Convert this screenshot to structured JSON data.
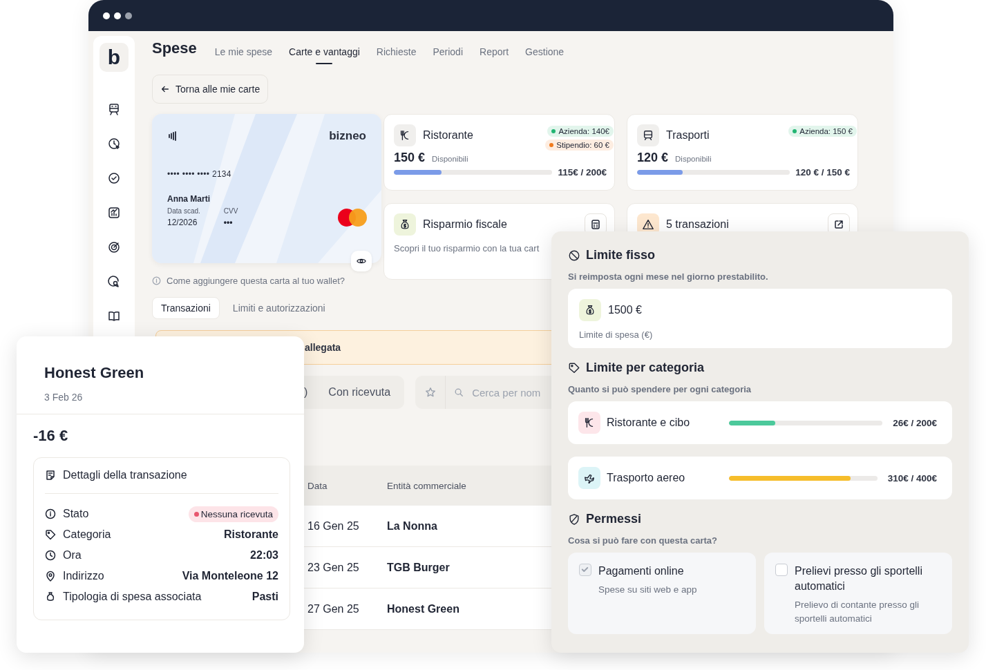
{
  "sidebar": {
    "logo": "b"
  },
  "header": {
    "title": "Spese",
    "tabs": [
      {
        "label": "Le mie spese",
        "selected": false
      },
      {
        "label": "Carte e vantaggi",
        "selected": true
      },
      {
        "label": "Richieste",
        "selected": false
      },
      {
        "label": "Periodi",
        "selected": false
      },
      {
        "label": "Report",
        "selected": false
      },
      {
        "label": "Gestione",
        "selected": false
      }
    ]
  },
  "back_button": "Torna alle mie carte",
  "card": {
    "brand": "bizneo",
    "number": "•••• •••• •••• 2134",
    "holder": "Anna Marti",
    "expiry_label": "Data scad.",
    "expiry": "12/2026",
    "cvv_label": "CVV",
    "cvv": "•••"
  },
  "wallet_hint": "Come aggiungere questa carta al tuo wallet?",
  "section_tabs": [
    {
      "label": "Transazioni",
      "selected": true
    },
    {
      "label": "Limiti e autorizzazioni",
      "selected": false
    }
  ],
  "budgets": [
    {
      "kind": "restaurant",
      "name": "Ristorante",
      "tags": [
        {
          "label": "Azienda: 140€",
          "color": "#22b573"
        },
        {
          "label": "Stipendio: 60 €",
          "color": "#f07b1f"
        }
      ],
      "amount": "150 €",
      "amount_label": "Disponibili",
      "level": 0.3,
      "reading": "115€ / 200€"
    },
    {
      "kind": "transport",
      "name": "Trasporti",
      "tags": [
        {
          "label": "Azienda: 150 €",
          "color": "#22b573"
        }
      ],
      "amount": "120 €",
      "amount_label": "Disponibili",
      "level": 0.3,
      "reading": "120 € / 150 €"
    }
  ],
  "promos": [
    {
      "kind": "savings",
      "title": "Risparmio fiscale",
      "text": "Scopri il tuo risparmio con la tua cart"
    },
    {
      "kind": "warning",
      "title": "5 transazioni"
    }
  ],
  "banner": "allegata",
  "filters": {
    "segments": [
      ")",
      "Con ricevuta"
    ],
    "search_placeholder": "Cerca per nom"
  },
  "table": {
    "columns": [
      "Data",
      "Entità commerciale"
    ],
    "rows": [
      {
        "date": "16 Gen 25",
        "merchant": "La Nonna"
      },
      {
        "date": "23 Gen 25",
        "merchant": "TGB Burger"
      },
      {
        "date": "27 Gen 25",
        "merchant": "Honest Green"
      }
    ]
  },
  "transaction": {
    "merchant": "Honest Green",
    "date": "3 Feb 26",
    "amount": "-16 €",
    "details_title": "Dettagli della transazione",
    "fields": [
      {
        "kind": "status",
        "label": "Stato",
        "value": "Nessuna ricevuta"
      },
      {
        "kind": "category",
        "label": "Categoria",
        "value": "Ristorante"
      },
      {
        "kind": "time",
        "label": "Ora",
        "value": "22:03"
      },
      {
        "kind": "address",
        "label": "Indirizzo",
        "value": "Via Monteleone 12"
      },
      {
        "kind": "expense",
        "label": "Tipologia di spesa associata",
        "value": "Pasti"
      }
    ]
  },
  "limits": {
    "fixed": {
      "title": "Limite fisso",
      "subtitle": "Si reimposta ogni mese nel giorno prestabilito.",
      "amount": "1500 €",
      "label": "Limite di spesa (€)"
    },
    "categories": {
      "title": "Limite per categoria",
      "subtitle": "Quanto si può spendere per ogni categoria",
      "items": [
        {
          "kind": "restaurant",
          "name": "Ristorante e cibo",
          "level": 0.3,
          "color": "#4cc99b",
          "reading": "26€ / 200€"
        },
        {
          "kind": "flight",
          "name": "Trasporto aereo",
          "level": 0.82,
          "color": "#f6bd2b",
          "reading": "310€ / 400€"
        }
      ]
    },
    "permissions": {
      "title": "Permessi",
      "subtitle": "Cosa si può fare con questa carta?",
      "items": [
        {
          "title": "Pagamenti online",
          "text": "Spese su siti web e app",
          "checked": true
        },
        {
          "title": "Prelievi presso gli sportelli automatici",
          "text": "Prelievo di contante presso gli sportelli automatici",
          "checked": false
        }
      ]
    }
  }
}
